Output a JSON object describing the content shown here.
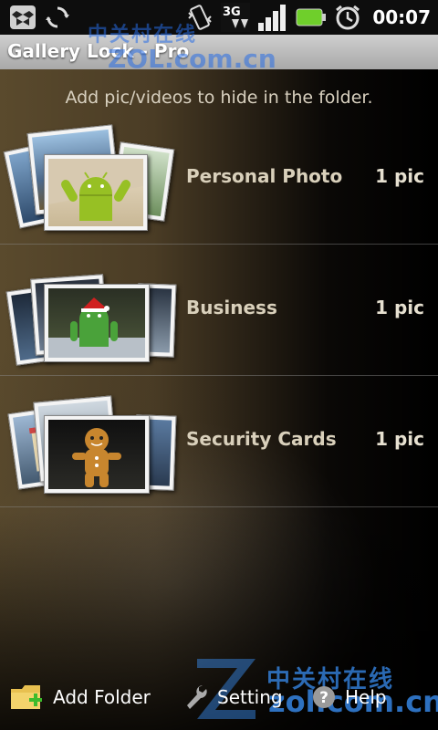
{
  "status_bar": {
    "time": "00:07",
    "network_label": "3G",
    "icons": [
      "dropbox-icon",
      "sync-icon",
      "vibrate-icon",
      "network-3g-icon",
      "signal-icon",
      "battery-icon",
      "alarm-icon"
    ]
  },
  "app": {
    "title": "Gallery Lock - Pro"
  },
  "watermark": {
    "top_cn": "中关村在线",
    "top_en": "ZOL.com.cn",
    "bottom_cn": "中关村在线",
    "bottom_en": "zol.com.cn"
  },
  "main": {
    "subtitle": "Add pic/videos to hide in the folder.",
    "folders": [
      {
        "name": "Personal Photo",
        "count": "1 pic",
        "thumb": "android-robot-with-arms-up"
      },
      {
        "name": "Business",
        "count": "1 pic",
        "thumb": "android-robot-santa-hat"
      },
      {
        "name": "Security Cards",
        "count": "1 pic",
        "thumb": "gingerbread-man"
      }
    ]
  },
  "bottom_bar": {
    "add_folder": "Add Folder",
    "setting": "Setting",
    "help": "Help"
  },
  "colors": {
    "title_bar": "#b5b5b5",
    "status_bar": "#0d0d0d",
    "folder_text": "#d9d0bb",
    "android_green": "#97c024"
  }
}
